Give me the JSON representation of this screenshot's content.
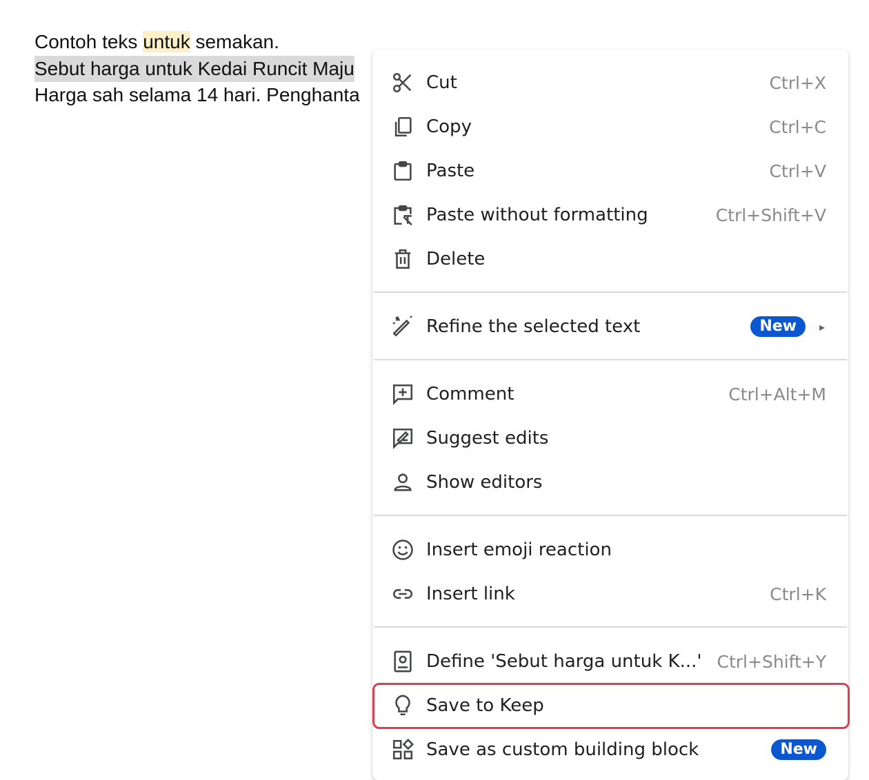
{
  "document": {
    "line1": {
      "before": "Contoh teks ",
      "highlight": "untuk",
      "after": " semakan."
    },
    "line2": "Sebut harga untuk Kedai Runcit Maju",
    "line3": "Harga sah selama 14 hari. Penghanta"
  },
  "context_menu": {
    "cut": {
      "label": "Cut",
      "shortcut": "Ctrl+X",
      "icon": "scissors-icon"
    },
    "copy": {
      "label": "Copy",
      "shortcut": "Ctrl+C",
      "icon": "copy-icon"
    },
    "paste": {
      "label": "Paste",
      "shortcut": "Ctrl+V",
      "icon": "clipboard-icon"
    },
    "paste_plain": {
      "label": "Paste without formatting",
      "shortcut": "Ctrl+Shift+V",
      "icon": "clipboard-clear-format-icon"
    },
    "delete": {
      "label": "Delete",
      "icon": "trash-icon"
    },
    "refine": {
      "label": "Refine the selected text",
      "badge": "New",
      "arrow": "▸",
      "icon": "magic-pen-icon"
    },
    "comment": {
      "label": "Comment",
      "shortcut": "Ctrl+Alt+M",
      "icon": "add-comment-icon"
    },
    "suggest": {
      "label": "Suggest edits",
      "icon": "suggest-edit-icon"
    },
    "show_editors": {
      "label": "Show editors",
      "icon": "person-icon"
    },
    "emoji": {
      "label": "Insert emoji reaction",
      "icon": "smiley-icon"
    },
    "link": {
      "label": "Insert link",
      "shortcut": "Ctrl+K",
      "icon": "link-icon"
    },
    "define": {
      "label": "Define 'Sebut harga untuk K...'",
      "shortcut": "Ctrl+Shift+Y",
      "icon": "dictionary-icon"
    },
    "keep": {
      "label": "Save to Keep",
      "icon": "lightbulb-icon"
    },
    "building_block": {
      "label": "Save as custom building block",
      "badge": "New",
      "icon": "building-block-icon"
    }
  },
  "colors": {
    "badge": "#0b57d0",
    "focus_ring": "#d9404f",
    "selection": "#dadada",
    "word_highlight": "#fdf0c8"
  }
}
